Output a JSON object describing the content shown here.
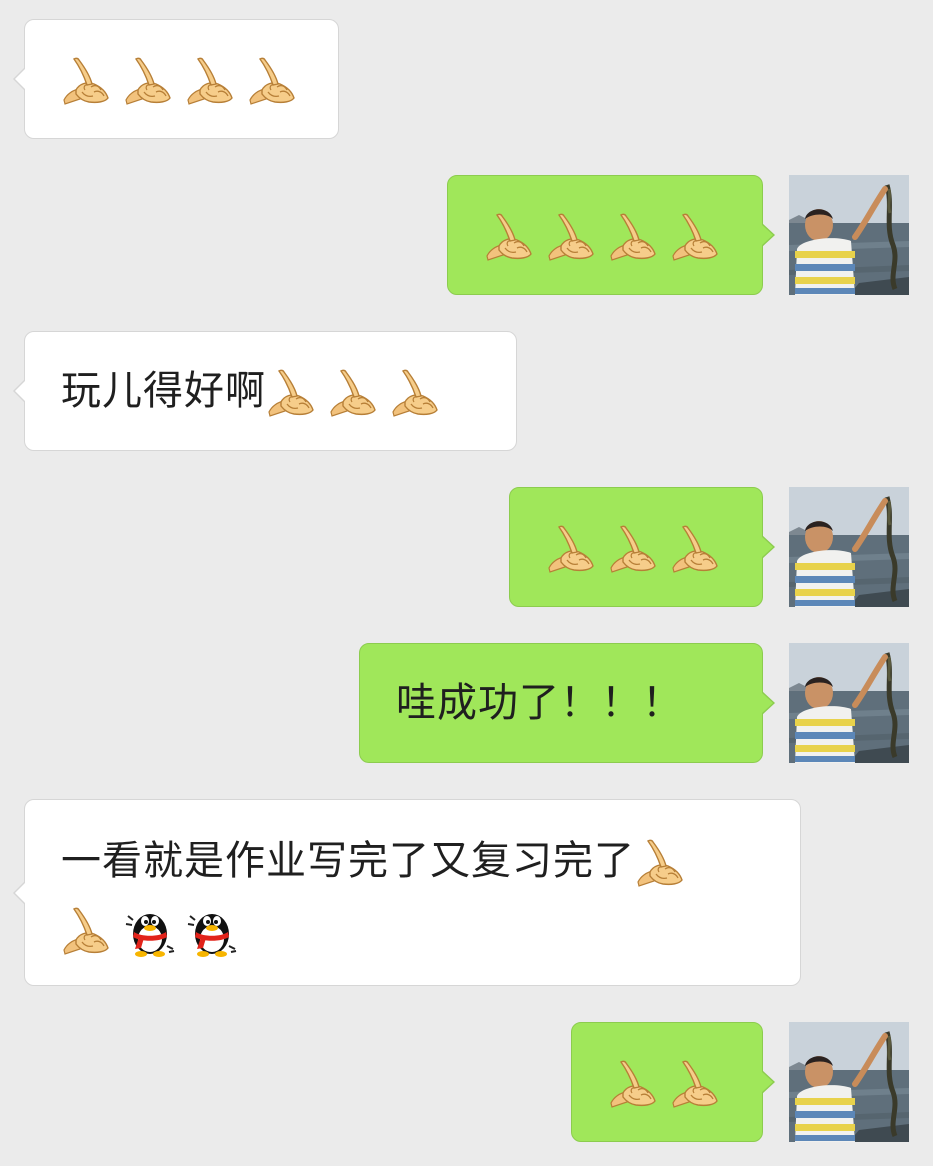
{
  "messages": [
    {
      "side": "incoming",
      "text": "",
      "emojis": [
        "ok-hand-emoji",
        "ok-hand-emoji",
        "ok-hand-emoji",
        "ok-hand-emoji"
      ]
    },
    {
      "side": "outgoing",
      "text": "",
      "emojis": [
        "ok-hand-emoji",
        "ok-hand-emoji",
        "ok-hand-emoji",
        "ok-hand-emoji"
      ]
    },
    {
      "side": "incoming",
      "text": "玩儿得好啊",
      "emojis": [
        "ok-hand-emoji",
        "ok-hand-emoji",
        "ok-hand-emoji"
      ]
    },
    {
      "side": "outgoing",
      "text": "",
      "emojis": [
        "ok-hand-emoji",
        "ok-hand-emoji",
        "ok-hand-emoji"
      ]
    },
    {
      "side": "outgoing",
      "text": "哇成功了！！！",
      "emojis": []
    },
    {
      "side": "incoming",
      "text": "一看就是作业写完了又复习完了",
      "emojis": [
        "ok-hand-emoji",
        "ok-hand-emoji",
        "qq-penguin-emoji",
        "qq-penguin-emoji"
      ]
    },
    {
      "side": "outgoing",
      "text": "",
      "emojis": [
        "ok-hand-emoji",
        "ok-hand-emoji"
      ]
    }
  ],
  "icons": {
    "ok_hand": "ok-hand-emoji",
    "qq_penguin": "qq-penguin-emoji",
    "avatar": "avatar-photo-boy-with-seaweed"
  },
  "colors": {
    "background": "#ebebeb",
    "incoming_bubble": "#ffffff",
    "outgoing_bubble": "#a0e75a"
  }
}
